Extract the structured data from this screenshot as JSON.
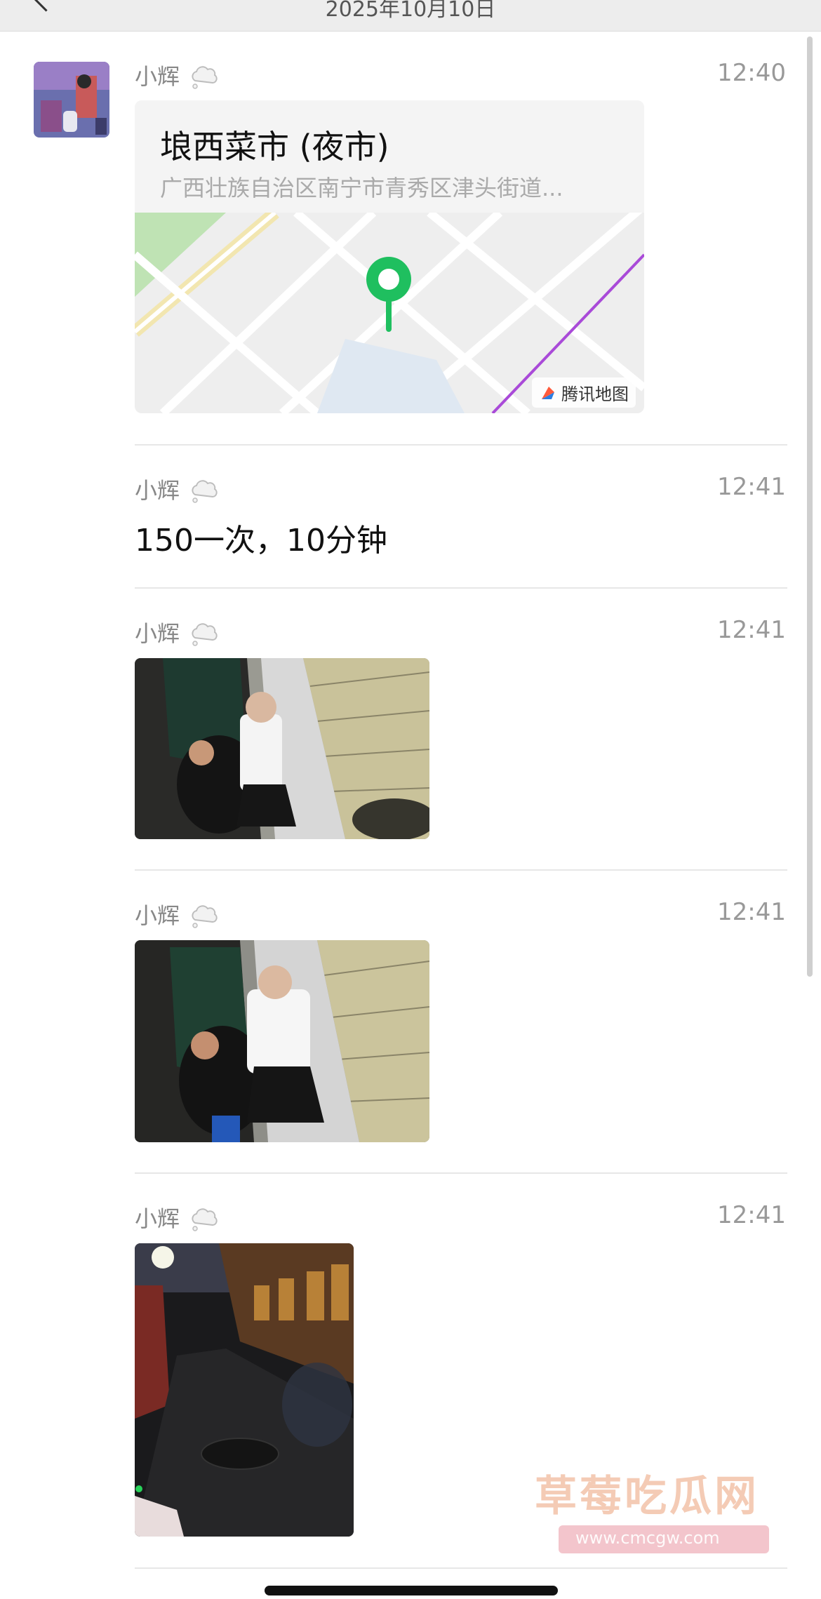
{
  "header": {
    "date": "2025年10月10日"
  },
  "sender": {
    "name": "小辉"
  },
  "messages": [
    {
      "type": "location",
      "time": "12:40",
      "title": "埌西菜市 (夜市)",
      "address": "广西壮族自治区南宁市青秀区津头街道...",
      "map_brand": "腾讯地图"
    },
    {
      "type": "text",
      "time": "12:41",
      "text": "150一次，10分钟"
    },
    {
      "type": "image",
      "time": "12:41"
    },
    {
      "type": "image",
      "time": "12:41"
    },
    {
      "type": "image",
      "time": "12:41"
    }
  ],
  "watermark": {
    "title": "草莓吃瓜网",
    "url": "www.cmcgw.com"
  },
  "colors": {
    "pin": "#1fbf5f",
    "background": "#ffffff",
    "topbar": "#ededed"
  }
}
